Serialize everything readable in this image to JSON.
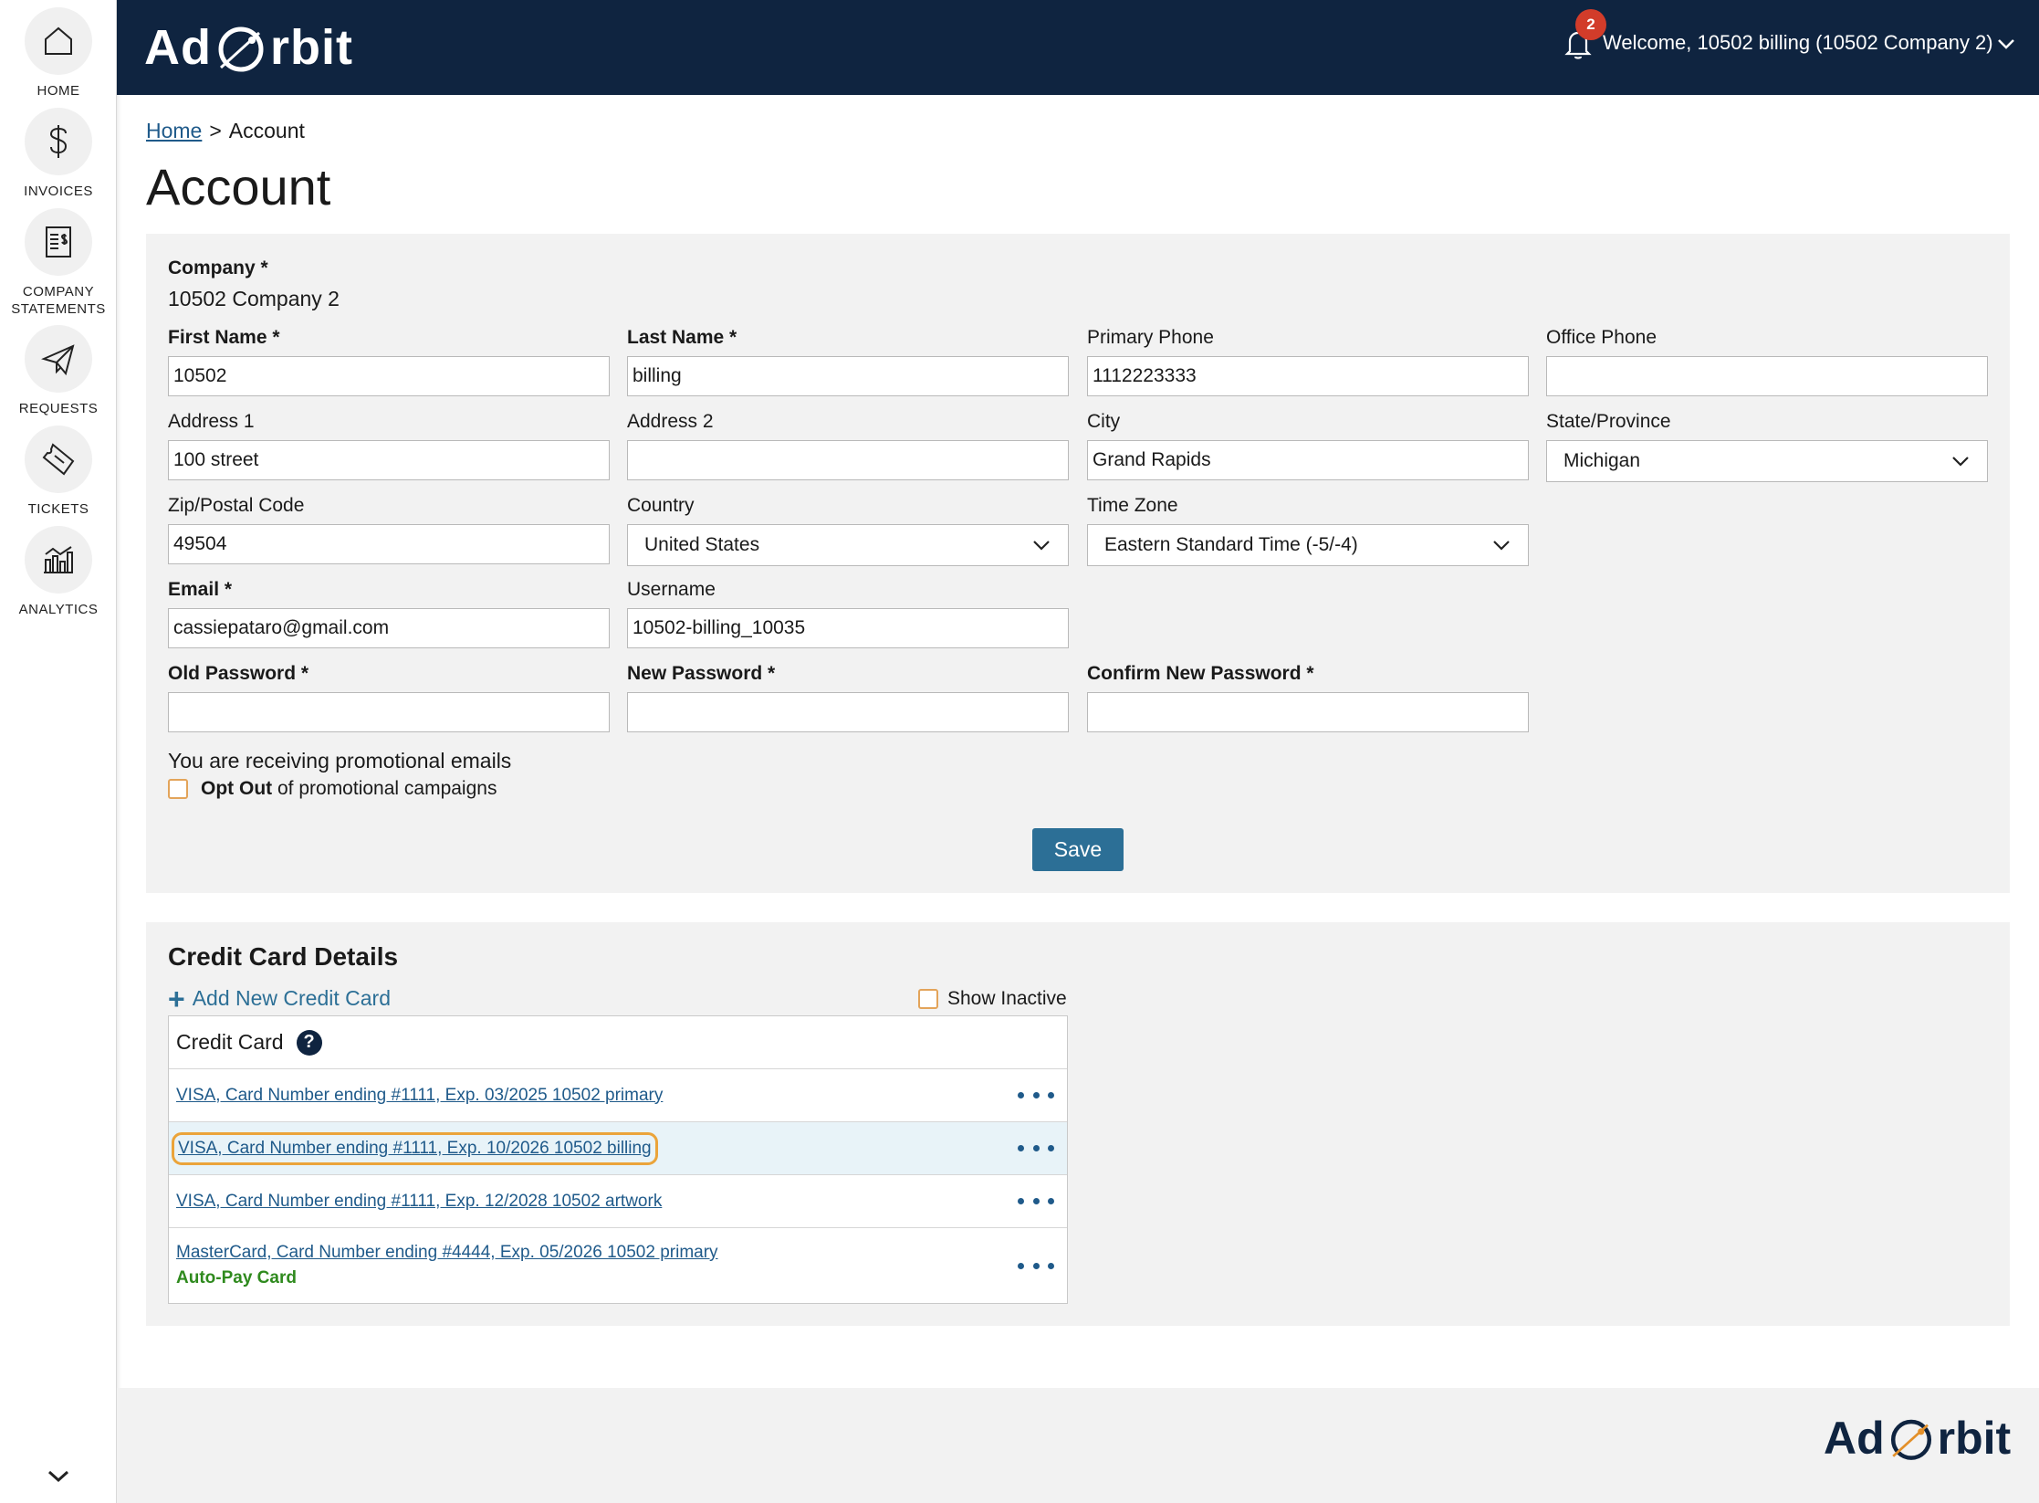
{
  "sidebar": {
    "items": [
      {
        "label": "HOME",
        "icon": "home-icon"
      },
      {
        "label": "INVOICES",
        "icon": "dollar-icon"
      },
      {
        "label": "COMPANY STATEMENTS",
        "icon": "statement-icon"
      },
      {
        "label": "REQUESTS",
        "icon": "paper-plane-icon"
      },
      {
        "label": "TICKETS",
        "icon": "ticket-icon"
      },
      {
        "label": "ANALYTICS",
        "icon": "bar-chart-icon"
      }
    ]
  },
  "header": {
    "logo_left": "Ad",
    "logo_right": "rbit",
    "notification_count": "2",
    "welcome": "Welcome, 10502 billing (10502 Company 2)",
    "background": "#0f2440"
  },
  "breadcrumb": {
    "home": "Home",
    "separator": ">",
    "current": "Account"
  },
  "page_title": "Account",
  "form": {
    "company_label": "Company *",
    "company_value": "10502 Company 2",
    "first_name": {
      "label": "First Name *",
      "value": "10502"
    },
    "last_name": {
      "label": "Last Name *",
      "value": "billing"
    },
    "primary_phone": {
      "label": "Primary Phone",
      "value": "1112223333"
    },
    "office_phone": {
      "label": "Office Phone",
      "value": ""
    },
    "address1": {
      "label": "Address 1",
      "value": "100 street"
    },
    "address2": {
      "label": "Address 2",
      "value": ""
    },
    "city": {
      "label": "City",
      "value": "Grand Rapids"
    },
    "state": {
      "label": "State/Province",
      "value": "Michigan"
    },
    "zip": {
      "label": "Zip/Postal Code",
      "value": "49504"
    },
    "country": {
      "label": "Country",
      "value": "United States"
    },
    "timezone": {
      "label": "Time Zone",
      "value": "Eastern Standard Time (-5/-4)"
    },
    "email": {
      "label": "Email *",
      "value": "cassiepataro@gmail.com"
    },
    "username": {
      "label": "Username",
      "value": "10502-billing_10035"
    },
    "old_password": {
      "label": "Old Password *",
      "value": ""
    },
    "new_password": {
      "label": "New Password *",
      "value": ""
    },
    "confirm_password": {
      "label": "Confirm New Password *",
      "value": ""
    },
    "promo_text": "You are receiving promotional emails",
    "opt_out_bold": "Opt Out",
    "opt_out_rest": " of promotional campaigns",
    "save_label": "Save"
  },
  "credit_cards": {
    "title": "Credit Card Details",
    "add_label": "Add New Credit Card",
    "show_inactive_label": "Show Inactive",
    "column_header": "Credit Card",
    "rows": [
      {
        "label": "VISA, Card Number ending #1111, Exp. 03/2025 10502 primary",
        "note": ""
      },
      {
        "label": "VISA, Card Number ending #1111, Exp. 10/2026 10502 billing",
        "note": ""
      },
      {
        "label": "VISA, Card Number ending #1111, Exp. 12/2028 10502 artwork",
        "note": ""
      },
      {
        "label": "MasterCard, Card Number ending #4444, Exp. 05/2026 10502 primary",
        "note": "Auto-Pay Card"
      }
    ]
  },
  "footer": {
    "logo_left": "Ad",
    "logo_right": "rbit"
  }
}
